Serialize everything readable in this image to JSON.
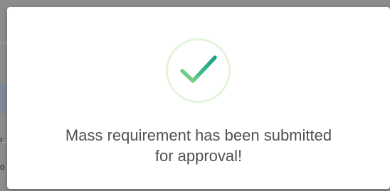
{
  "background": {
    "overlay_color": "#8c8c8c",
    "fragment_1": "r",
    "fragment_2": "o"
  },
  "dialog": {
    "icon": "success-check-icon",
    "ring_color": "#e3f4dc",
    "check_color_start": "#8bd17c",
    "check_color_end": "#16a085",
    "message_line1": "Mass requirement has been submitted",
    "message_line2": "for approval!"
  }
}
